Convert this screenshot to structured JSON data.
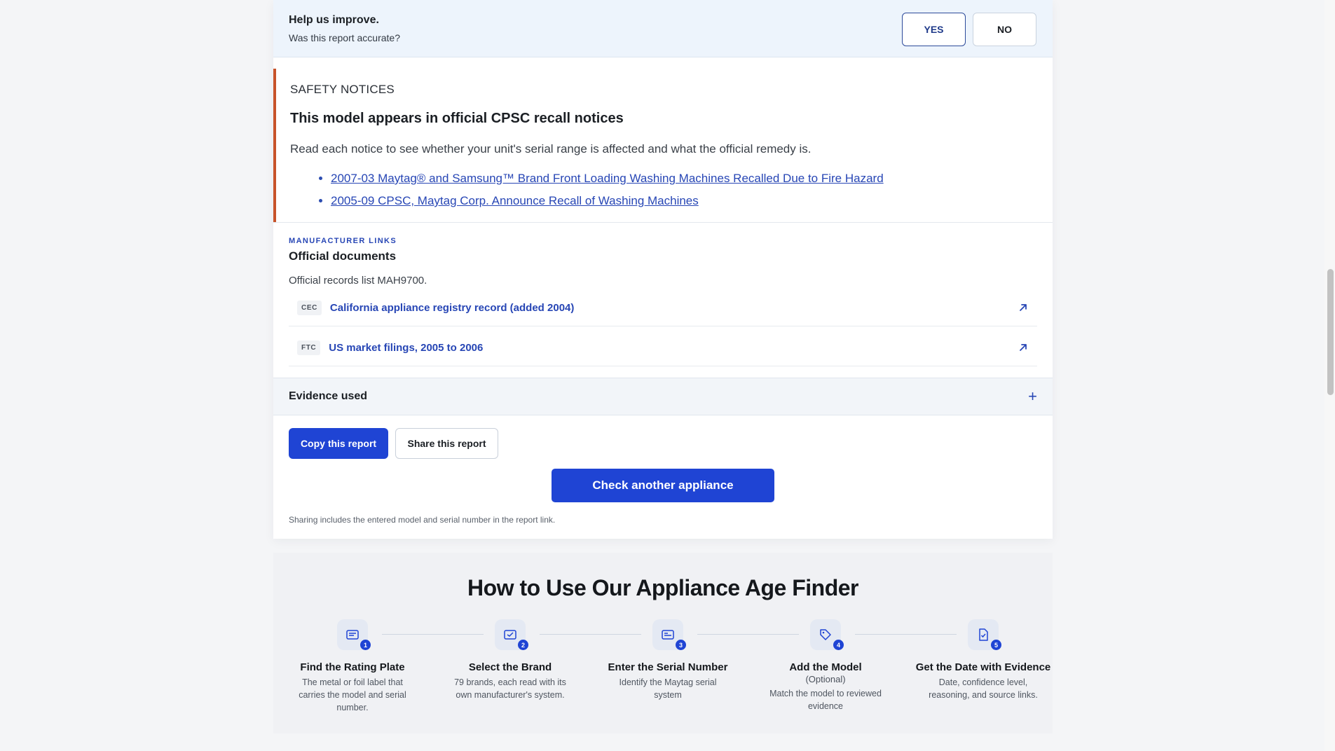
{
  "feedback": {
    "title": "Help us improve.",
    "subtitle": "Was this report accurate?",
    "yes_label": "YES",
    "no_label": "NO"
  },
  "safety": {
    "label": "SAFETY NOTICES",
    "title": "This model appears in official CPSC recall notices",
    "description": "Read each notice to see whether your unit's serial range is affected and what the official remedy is.",
    "notices": [
      "2007-03 Maytag® and Samsung™ Brand Front Loading Washing Machines Recalled Due to Fire Hazard",
      "2005-09 CPSC, Maytag Corp. Announce Recall of Washing Machines"
    ],
    "accent_color": "#c8532a"
  },
  "manufacturer": {
    "eyebrow": "MANUFACTURER LINKS",
    "title": "Official documents",
    "description": "Official records list MAH9700.",
    "documents": [
      {
        "tag": "CEC",
        "label": "California appliance registry record (added 2004)",
        "icon": "external-link-icon"
      },
      {
        "tag": "FTC",
        "label": "US market filings, 2005 to 2006",
        "icon": "external-link-icon"
      }
    ]
  },
  "evidence": {
    "label": "Evidence used",
    "icon": "plus-icon"
  },
  "actions": {
    "copy_label": "Copy this report",
    "share_label": "Share this report",
    "check_label": "Check another appliance",
    "share_note": "Sharing includes the entered model and serial number in the report link."
  },
  "howto": {
    "title": "How to Use Our Appliance Age Finder",
    "steps": [
      {
        "num": "1",
        "icon": "rating-plate-icon",
        "title": "Find the Rating Plate",
        "optional": "",
        "desc": "The metal or foil label that carries the model and serial number."
      },
      {
        "num": "2",
        "icon": "brand-select-icon",
        "title": "Select the Brand",
        "optional": "",
        "desc": "79 brands, each read with its own manufacturer's system."
      },
      {
        "num": "3",
        "icon": "serial-number-icon",
        "title": "Enter the Serial Number",
        "optional": "",
        "desc": "Identify the Maytag serial system"
      },
      {
        "num": "4",
        "icon": "model-tag-icon",
        "title": "Add the Model",
        "optional": "(Optional)",
        "desc": "Match the model to reviewed evidence"
      },
      {
        "num": "5",
        "icon": "date-evidence-icon",
        "title": "Get the Date with Evidence",
        "optional": "",
        "desc": "Date, confidence level, reasoning, and source links."
      }
    ]
  },
  "colors": {
    "primary": "#1f44d4",
    "link": "#2746b5",
    "alert_border": "#c8532a"
  }
}
